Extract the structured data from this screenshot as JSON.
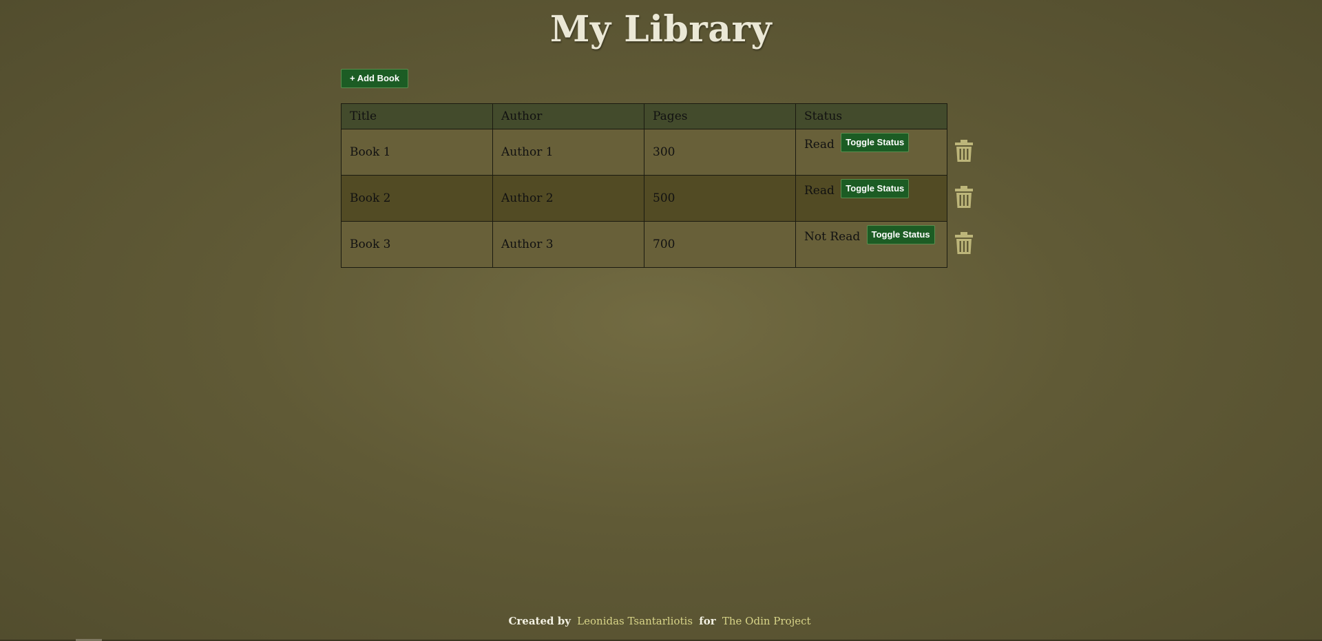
{
  "header": {
    "title": "My Library"
  },
  "toolbar": {
    "add_label": "+ Add Book"
  },
  "table": {
    "columns": [
      "Title",
      "Author",
      "Pages",
      "Status"
    ],
    "rows": [
      {
        "title": "Book 1",
        "author": "Author 1",
        "pages": "300",
        "status": "Read",
        "toggle_label": "Toggle Status"
      },
      {
        "title": "Book 2",
        "author": "Author 2",
        "pages": "500",
        "status": "Read",
        "toggle_label": "Toggle Status"
      },
      {
        "title": "Book 3",
        "author": "Author 3",
        "pages": "700",
        "status": "Not Read",
        "toggle_label": "Toggle Status"
      }
    ],
    "delete_icon": "trash-icon"
  },
  "footer": {
    "created_by": "Created by",
    "author_link": "Leonidas Tsantarliotis",
    "for_text": "for",
    "project_link": "The Odin Project"
  },
  "colors": {
    "button_bg": "#1c5c24",
    "trash_icon": "#bdb67a",
    "link": "#d8d488",
    "title": "#ebe8d6"
  }
}
